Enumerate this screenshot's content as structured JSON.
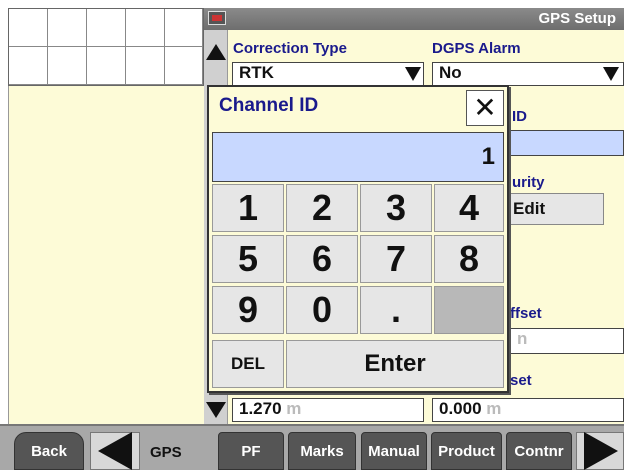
{
  "header": {
    "title": "GPS Setup",
    "monitor_icon": "monitor-icon"
  },
  "fields": {
    "correction_type": {
      "label": "Correction Type",
      "value": "RTK"
    },
    "dgps_alarm": {
      "label": "DGPS Alarm",
      "value": "No"
    },
    "id_label_partial": "ID",
    "security_label_partial": "urity",
    "edit_label": "Edit",
    "offset_label_partial": "ffset",
    "offset_unit_partial": "n",
    "set_label_partial": "set",
    "value_left": "1.270",
    "value_left_unit": "m",
    "value_right": "0.000",
    "value_right_unit": "m"
  },
  "dialog": {
    "title": "Channel ID",
    "close_icon": "close-icon",
    "display_value": "1",
    "keys": [
      "1",
      "2",
      "3",
      "4",
      "5",
      "6",
      "7",
      "8",
      "9",
      "0",
      "."
    ],
    "del_label": "DEL",
    "enter_label": "Enter"
  },
  "bottom_nav": {
    "back": "Back",
    "gps": "GPS",
    "pf": "PF",
    "marks": "Marks",
    "manual": "Manual",
    "product": "Product",
    "contnr": "Contnr"
  }
}
